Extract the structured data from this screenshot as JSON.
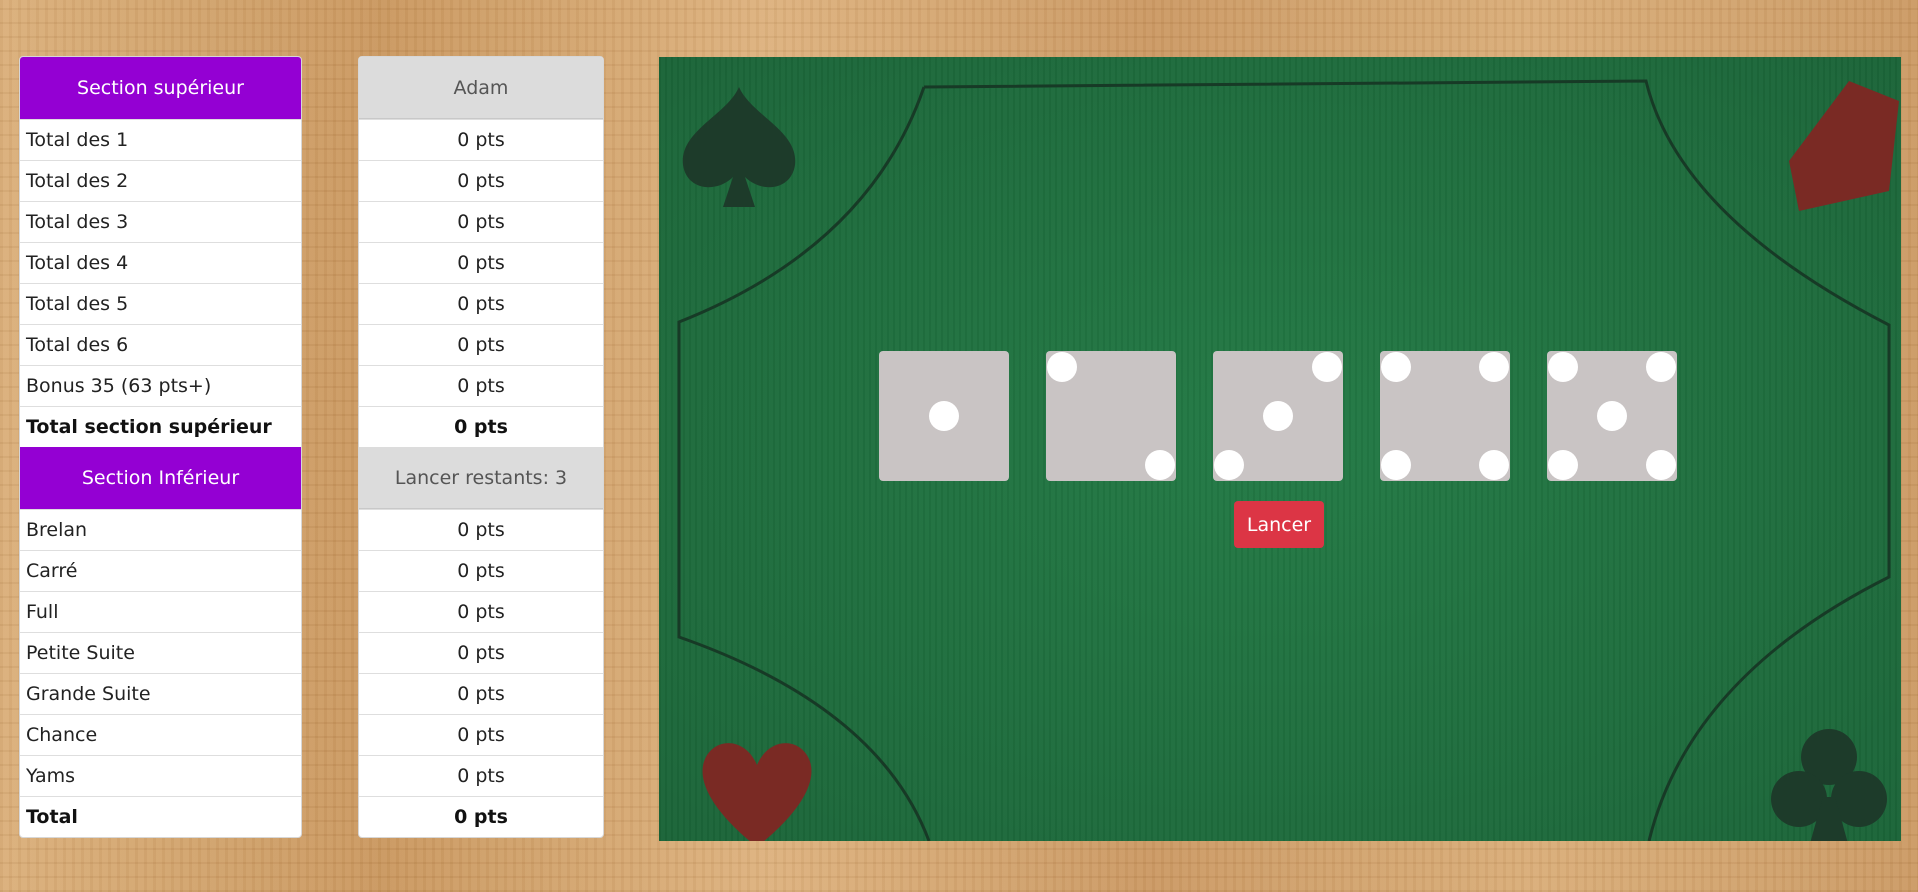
{
  "upper": {
    "header": "Section supérieur",
    "rows": [
      {
        "label": "Total des 1",
        "score": "0 pts"
      },
      {
        "label": "Total des 2",
        "score": "0 pts"
      },
      {
        "label": "Total des 3",
        "score": "0 pts"
      },
      {
        "label": "Total des 4",
        "score": "0 pts"
      },
      {
        "label": "Total des 5",
        "score": "0 pts"
      },
      {
        "label": "Total des 6",
        "score": "0 pts"
      },
      {
        "label": "Bonus 35 (63 pts+)",
        "score": "0 pts"
      }
    ],
    "total_label": "Total section supérieur",
    "total_score": "0 pts"
  },
  "lower": {
    "header": "Section Inférieur",
    "rows": [
      {
        "label": "Brelan",
        "score": "0 pts"
      },
      {
        "label": "Carré",
        "score": "0 pts"
      },
      {
        "label": "Full",
        "score": "0 pts"
      },
      {
        "label": "Petite Suite",
        "score": "0 pts"
      },
      {
        "label": "Grande Suite",
        "score": "0 pts"
      },
      {
        "label": "Chance",
        "score": "0 pts"
      },
      {
        "label": "Yams",
        "score": "0 pts"
      }
    ],
    "total_label": "Total",
    "total_score": "0 pts"
  },
  "player": {
    "name": "Adam"
  },
  "rolls_remaining_text": "Lancer restants: 3",
  "dice": [
    1,
    2,
    3,
    4,
    5
  ],
  "roll_button_label": "Lancer",
  "colors": {
    "section_header": "#9400d3",
    "player_header": "#dcdcdc",
    "roll_button": "#dc3545",
    "felt": "#1f6e3e",
    "die_face": "#c9c4c4",
    "pip": "#ffffff",
    "suit_dark": "#1d3b2a",
    "suit_red": "#7a2a24"
  },
  "board_icons": [
    "spade-icon",
    "diamond-icon",
    "heart-icon",
    "club-icon"
  ]
}
